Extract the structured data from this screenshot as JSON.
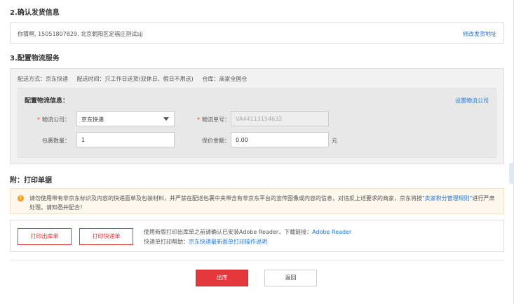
{
  "sections": {
    "confirm_shipping": "2.确认发货信息",
    "logistics_service": "3.配置物流服务",
    "print_documents": "附：打印单据"
  },
  "shipping": {
    "address_line": "你猜啊, 15051807829, 北京朝阳区定福庄测试sjj",
    "edit_link": "修改发货地址"
  },
  "logistics": {
    "method": "配送方式：京东快递",
    "time": "配送时间：只工作日送货(双休日、假日不用送)",
    "warehouse": "仓库：商家全国仓",
    "panel_title": "配置物流信息：",
    "set_company_link": "设置物流公司",
    "company_label": "物流公司：",
    "company_value": "京东快递",
    "tracking_label": "物流单号：",
    "tracking_value": "VA44113154632",
    "package_label": "包裹数量：",
    "package_value": "1",
    "insurance_label": "保价金额：",
    "insurance_value": "0.00",
    "insurance_unit": "元"
  },
  "notice": {
    "icon": "!",
    "text_before": "请勿使用带有非京东标识及内容的快递面单及包装材料，并严禁在配送包裹中夹带含有非京东平台的宣传图像或内容的信息，对违反上述要求的商家，京东将按",
    "link": "\"卖家积分管理规则\"",
    "text_after": "进行严肃处理。请知悉并配合！"
  },
  "print": {
    "print_outbound": "打印出库单",
    "print_express": "打印快递单",
    "reader_hint": "使用新版打印出库单之前请确认已安装Adobe Reader，下载链接：",
    "reader_link": "Adobe Reader",
    "help_label": "快递单打印帮助：",
    "help_link": "京东快递最新面单打印操作说明"
  },
  "actions": {
    "ship": "出库",
    "back": "返回"
  },
  "colors": {
    "accent_red": "#e4393c",
    "link_blue": "#1e78d8",
    "warning_orange": "#f3a31f"
  }
}
